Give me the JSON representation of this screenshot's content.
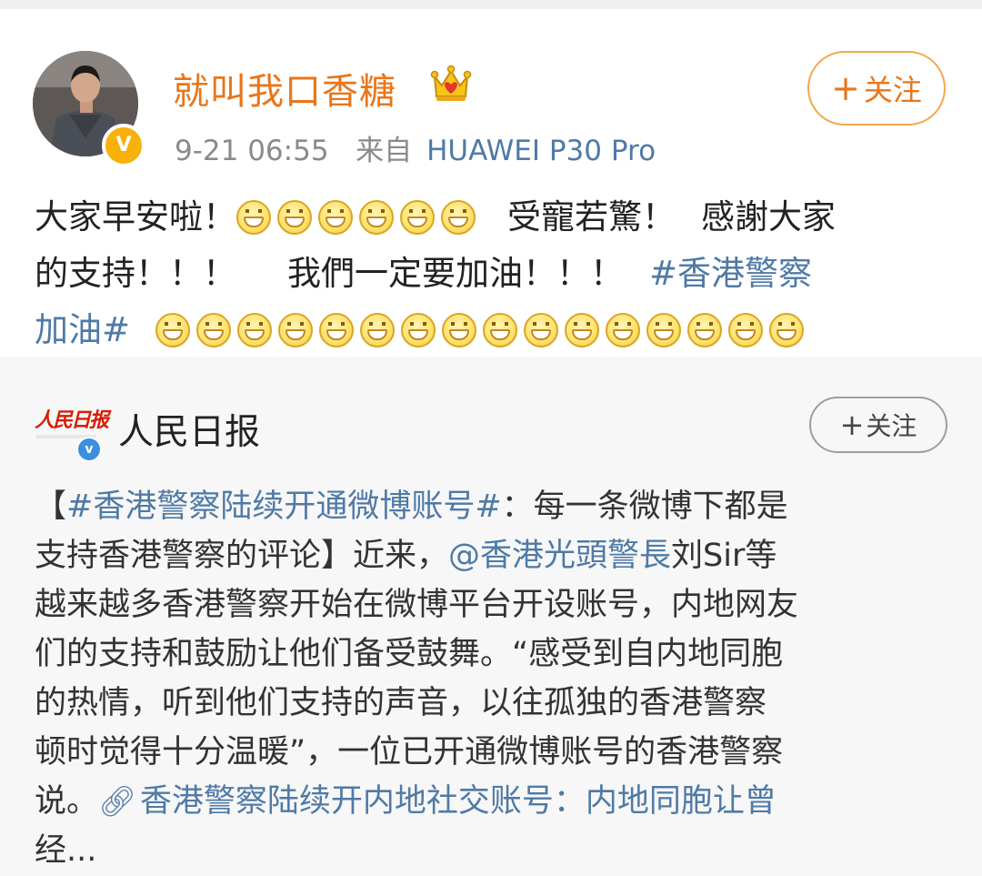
{
  "post": {
    "username": "就叫我口香糖",
    "time": "9-21 06:55",
    "source_prefix": "来自",
    "device": "HUAWEI P30 Pro",
    "follow_button": {
      "plus": "+",
      "label": "关注"
    },
    "text": {
      "line1_a": "大家早安啦！",
      "line1_b": "受寵若驚！",
      "line1_c": "感謝大家",
      "line2_a": "的支持！！！",
      "line2_b": "我們一定要加油！！！",
      "line2_hashtag": "#香港警察",
      "line3_hashtag": "加油#"
    },
    "emoji_counts": {
      "line1": 6,
      "line3": 16
    }
  },
  "repost": {
    "name": "人民日报",
    "logo_text": "人民日报",
    "follow_button": {
      "plus": "+",
      "label": "关注"
    },
    "text": {
      "l1_open": "【",
      "l1_hashtag": "#香港警察陆续开通微博账号#",
      "l1_rest": "：每一条微博下都是",
      "l2_a": "支持香港警察的评论】近来，",
      "l2_mention": "@香港光頭警長",
      "l2_b": " 刘Sir等",
      "l3": "越来越多香港警察开始在微博平台开设账号，内地网友",
      "l4": "们的支持和鼓励让他们备受鼓舞。“感受到自内地同胞",
      "l5": "的热情，听到他们支持的声音，以往孤独的香港警察",
      "l6": "顿时觉得十分温暖”，一位已开通微博账号的香港警察",
      "l7_a": "说。",
      "l7_link": "香港警察陆续开内地社交账号：内地同胞让曾",
      "l8": "经..."
    }
  },
  "colors": {
    "username": "#e8761a",
    "link": "#4f7aa6",
    "follow_border": "#f1a94f",
    "verified_gold": "#f7b10a",
    "verified_blue": "#3a8fde",
    "repost_bg": "#f7f7f7"
  },
  "icons": {
    "crown": "crown-badge-icon",
    "verified": "verified-v-icon",
    "emoji": "grin-emoji-icon",
    "link": "link-icon"
  }
}
